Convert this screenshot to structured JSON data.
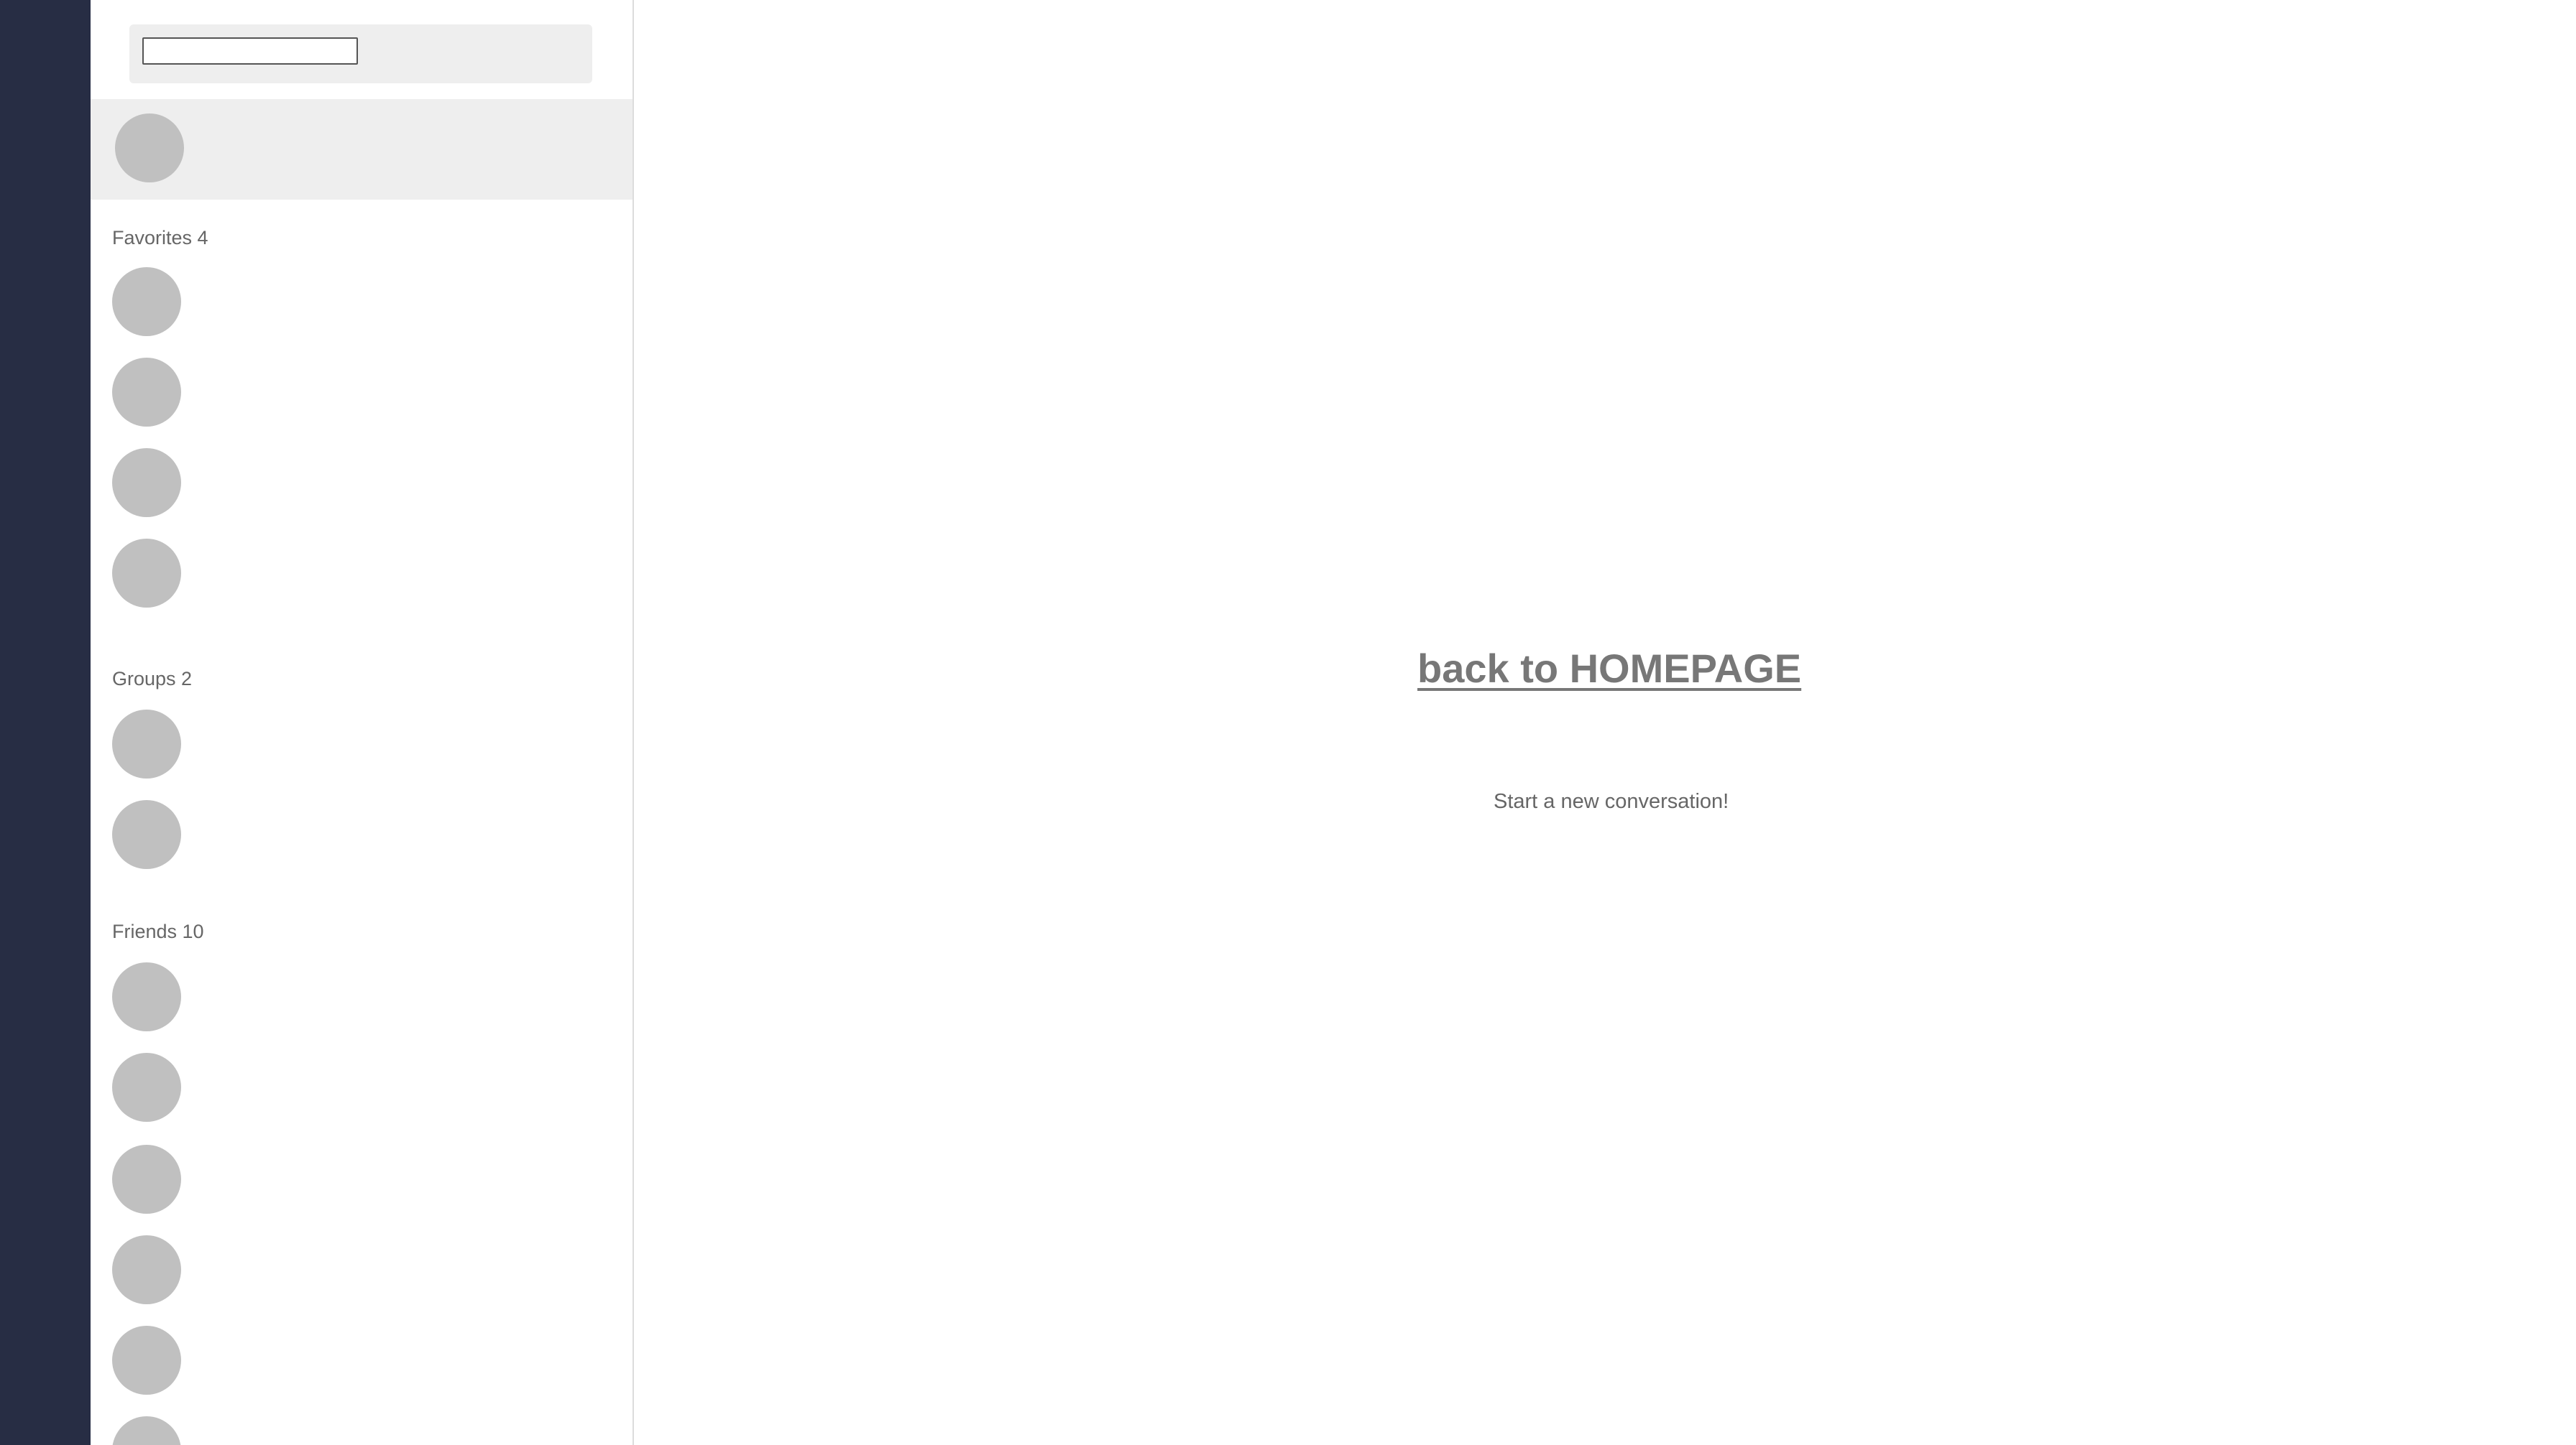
{
  "search": {
    "value": "",
    "placeholder": ""
  },
  "sections": {
    "favorites_label": "Favorites 4",
    "groups_label": "Groups 2",
    "friends_label": "Friends 10"
  },
  "main": {
    "home_link": "back to HOMEPAGE",
    "empty_message": "Start a new conversation!"
  },
  "colors": {
    "rail": "#272d44",
    "avatar_placeholder": "#c0c0c0",
    "panel_gray": "#eeeeee",
    "text_gray": "#666666"
  }
}
